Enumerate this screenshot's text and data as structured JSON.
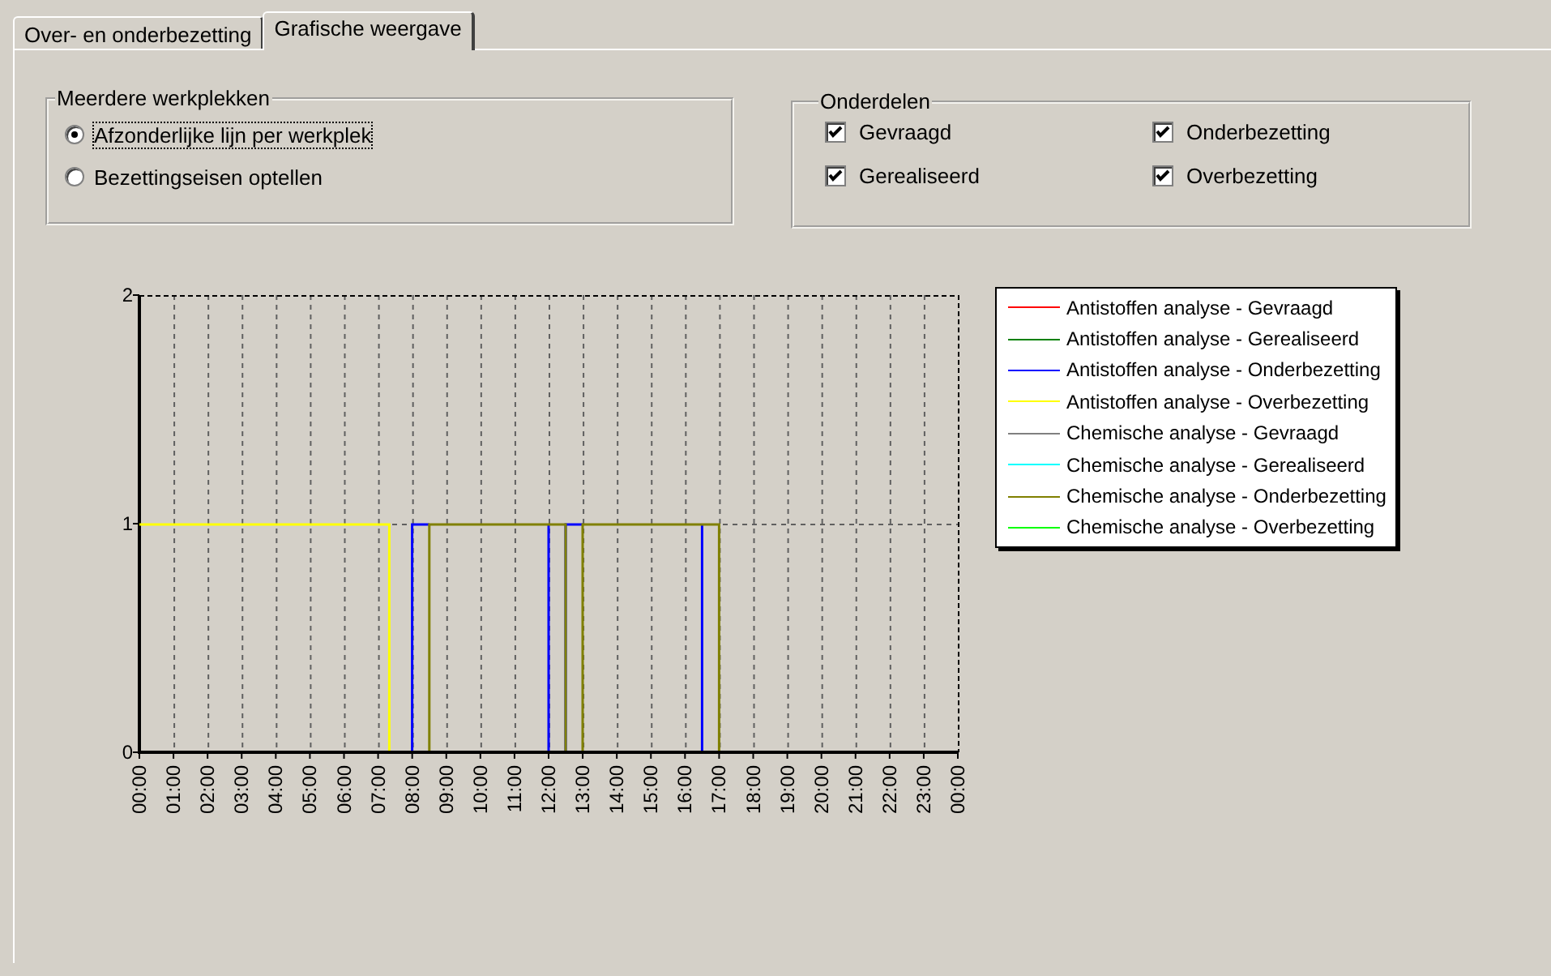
{
  "tabs": [
    {
      "label": "Over- en onderbezetting",
      "selected": false
    },
    {
      "label": "Grafische weergave",
      "selected": true
    }
  ],
  "multiple_workstations": {
    "title": "Meerdere werkplekken",
    "options": [
      {
        "label": "Afzonderlijke lijn per werkplek",
        "selected": true,
        "focused": true
      },
      {
        "label": "Bezettingseisen optellen",
        "selected": false,
        "focused": false
      }
    ]
  },
  "components": {
    "title": "Onderdelen",
    "items": [
      {
        "label": "Gevraagd",
        "checked": true
      },
      {
        "label": "Onderbezetting",
        "checked": true
      },
      {
        "label": "Gerealiseerd",
        "checked": true
      },
      {
        "label": "Overbezetting",
        "checked": true
      }
    ]
  },
  "chart_data": {
    "type": "line",
    "x": [
      0,
      7.33,
      7.33,
      8,
      8,
      8.5,
      8.5,
      12,
      12,
      12.25,
      12.5,
      12.5,
      12.75,
      13,
      13,
      16.5,
      16.5,
      17,
      17
    ],
    "xlim": [
      0,
      24
    ],
    "ylim": [
      0,
      2
    ],
    "yticks": [
      0,
      1,
      2
    ],
    "grid": true,
    "xticks": [
      {
        "value": 0,
        "label": "00:00"
      },
      {
        "value": 1,
        "label": "01:00"
      },
      {
        "value": 2,
        "label": "02:00"
      },
      {
        "value": 3,
        "label": "03:00"
      },
      {
        "value": 4,
        "label": "04:00"
      },
      {
        "value": 5,
        "label": "05:00"
      },
      {
        "value": 6,
        "label": "06:00"
      },
      {
        "value": 7,
        "label": "07:00"
      },
      {
        "value": 8,
        "label": "08:00"
      },
      {
        "value": 9,
        "label": "09:00"
      },
      {
        "value": 10,
        "label": "10:00"
      },
      {
        "value": 11,
        "label": "11:00"
      },
      {
        "value": 12,
        "label": "12:00"
      },
      {
        "value": 13,
        "label": "13:00"
      },
      {
        "value": 14,
        "label": "14:00"
      },
      {
        "value": 15,
        "label": "15:00"
      },
      {
        "value": 16,
        "label": "16:00"
      },
      {
        "value": 17,
        "label": "17:00"
      },
      {
        "value": 18,
        "label": "18:00"
      },
      {
        "value": 19,
        "label": "19:00"
      },
      {
        "value": 20,
        "label": "20:00"
      },
      {
        "value": 21,
        "label": "21:00"
      },
      {
        "value": 22,
        "label": "22:00"
      },
      {
        "value": 23,
        "label": "23:00"
      },
      {
        "value": 24,
        "label": "00:00"
      }
    ],
    "series": [
      {
        "name": "Antistoffen analyse - Gevraagd",
        "color": "#ff0000",
        "values": [
          null,
          null,
          null,
          null,
          null,
          null,
          null,
          null,
          null,
          null,
          null,
          null,
          null,
          null,
          null,
          null,
          null,
          null,
          null
        ]
      },
      {
        "name": "Antistoffen analyse - Gerealiseerd",
        "color": "#008000",
        "values": [
          null,
          null,
          null,
          null,
          null,
          null,
          null,
          null,
          null,
          null,
          null,
          null,
          null,
          null,
          null,
          null,
          null,
          null,
          null
        ]
      },
      {
        "name": "Antistoffen analyse - Onderbezetting",
        "color": "#0000ff",
        "values": [
          null,
          null,
          null,
          0,
          1,
          1,
          null,
          1,
          0,
          null,
          0,
          1,
          1,
          1,
          null,
          1,
          0,
          null,
          null
        ]
      },
      {
        "name": "Antistoffen analyse - Overbezetting",
        "color": "#ffff00",
        "values": [
          1,
          1,
          0,
          null,
          null,
          null,
          null,
          null,
          null,
          null,
          null,
          null,
          null,
          null,
          null,
          null,
          null,
          null,
          null
        ]
      },
      {
        "name": "Chemische analyse - Gevraagd",
        "color": "#808080",
        "values": [
          null,
          null,
          null,
          null,
          null,
          null,
          null,
          null,
          null,
          null,
          null,
          null,
          null,
          null,
          null,
          null,
          null,
          null,
          null
        ]
      },
      {
        "name": "Chemische analyse - Gerealiseerd",
        "color": "#00ffff",
        "values": [
          null,
          null,
          null,
          null,
          null,
          null,
          null,
          null,
          null,
          null,
          null,
          null,
          null,
          null,
          null,
          null,
          null,
          null,
          null
        ]
      },
      {
        "name": "Chemische analyse - Onderbezetting",
        "color": "#808000",
        "values": [
          null,
          null,
          null,
          null,
          null,
          0,
          1,
          1,
          1,
          1,
          1,
          0,
          null,
          0,
          1,
          1,
          1,
          1,
          0
        ]
      },
      {
        "name": "Chemische analyse - Overbezetting",
        "color": "#00ff00",
        "values": [
          null,
          null,
          null,
          null,
          null,
          null,
          null,
          null,
          null,
          null,
          null,
          null,
          null,
          null,
          null,
          null,
          null,
          null,
          null
        ]
      }
    ]
  }
}
